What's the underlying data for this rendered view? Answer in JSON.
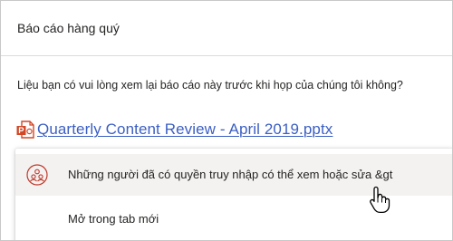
{
  "email": {
    "subject": "Báo cáo hàng quý",
    "body": "Liệu bạn có vui lòng xem lại báo cáo này trước khi họp của chúng tôi không?"
  },
  "attachment": {
    "name": "Quarterly Content Review - April 2019.pptx",
    "icon": "powerpoint-file-icon"
  },
  "context_menu": {
    "items": [
      {
        "label": "Những người đã có quyền truy nhập có thể xem hoặc sửa &gt",
        "icon": "share-people-icon"
      },
      {
        "label": "Mở trong tab mới"
      }
    ]
  },
  "colors": {
    "link": "#3b5fc4",
    "ppt_orange": "#d24726",
    "menu_hover": "#f3f2f1"
  }
}
